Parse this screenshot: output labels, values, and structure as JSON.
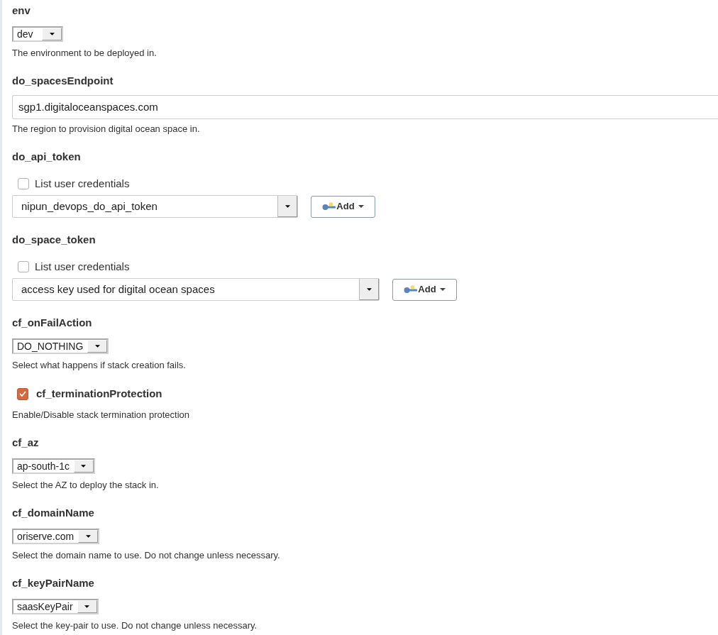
{
  "parameters": [
    {
      "kind": "select",
      "name": "env",
      "value": "dev",
      "description": "The environment to be deployed in."
    },
    {
      "kind": "text",
      "name": "do_spacesEndpoint",
      "value": "sgp1.digitaloceanspaces.com",
      "description": "The region to provision digital ocean space in."
    },
    {
      "kind": "credentials",
      "name": "do_api_token",
      "list_user_credentials": {
        "label": "List user credentials",
        "checked": false
      },
      "value": "nipun_devops_do_api_token",
      "add_button": "Add"
    },
    {
      "kind": "credentials",
      "name": "do_space_token",
      "list_user_credentials": {
        "label": "List user credentials",
        "checked": false
      },
      "value": "access key used for digital ocean spaces",
      "add_button": "Add"
    },
    {
      "kind": "select",
      "name": "cf_onFailAction",
      "value": "DO_NOTHING",
      "description": "Select what happens if stack creation fails."
    },
    {
      "kind": "boolean",
      "name": "cf_terminationProtection",
      "checked": true,
      "description": "Enable/Disable stack termination protection"
    },
    {
      "kind": "select",
      "name": "cf_az",
      "value": "ap-south-1c",
      "description": "Select the AZ to deploy the stack in."
    },
    {
      "kind": "select",
      "name": "cf_domainName",
      "value": "oriserve.com",
      "description": "Select the domain name to use. Do not change unless necessary."
    },
    {
      "kind": "select",
      "name": "cf_keyPairName",
      "value": "saasKeyPair",
      "description": "Select the key-pair to use. Do not change unless necessary."
    }
  ]
}
